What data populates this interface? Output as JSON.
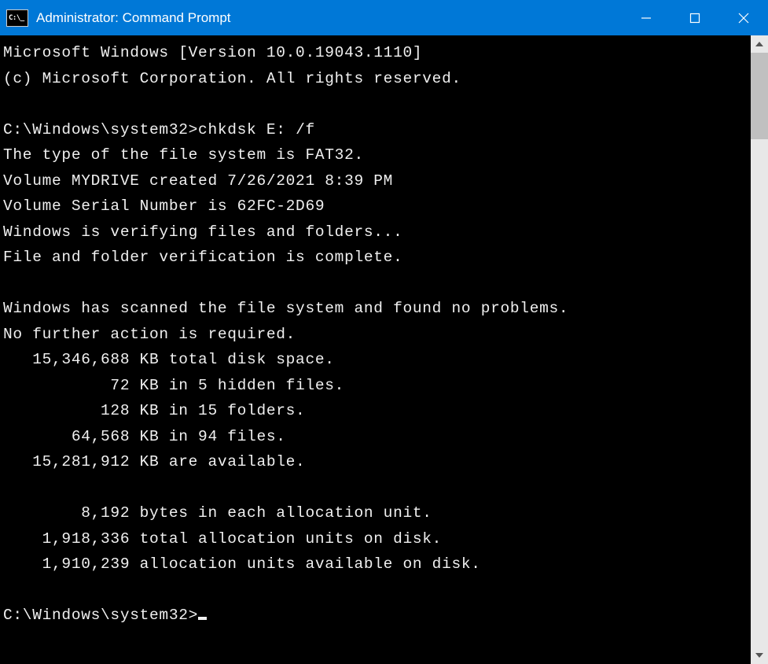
{
  "window": {
    "title": "Administrator: Command Prompt"
  },
  "terminal": {
    "banner1": "Microsoft Windows [Version 10.0.19043.1110]",
    "banner2": "(c) Microsoft Corporation. All rights reserved.",
    "prompt1": "C:\\Windows\\system32>",
    "command1": "chkdsk E: /f",
    "line_fs_type": "The type of the file system is FAT32.",
    "line_vol_created": "Volume MYDRIVE created 7/26/2021 8:39 PM",
    "line_vol_serial": "Volume Serial Number is 62FC-2D69",
    "line_verifying": "Windows is verifying files and folders...",
    "line_verif_complete": "File and folder verification is complete.",
    "line_no_problems": "Windows has scanned the file system and found no problems.",
    "line_no_action": "No further action is required.",
    "line_total_space": "   15,346,688 KB total disk space.",
    "line_hidden": "           72 KB in 5 hidden files.",
    "line_folders": "          128 KB in 15 folders.",
    "line_files": "       64,568 KB in 94 files.",
    "line_available": "   15,281,912 KB are available.",
    "line_bytes_au": "        8,192 bytes in each allocation unit.",
    "line_total_au": "    1,918,336 total allocation units on disk.",
    "line_avail_au": "    1,910,239 allocation units available on disk.",
    "prompt2": "C:\\Windows\\system32>"
  }
}
